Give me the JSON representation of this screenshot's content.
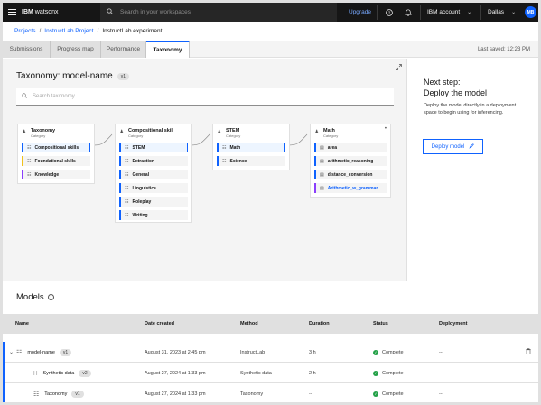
{
  "header": {
    "brand_bold": "IBM",
    "brand_rest": "watsonx",
    "search_placeholder": "Search in your workspaces",
    "upgrade": "Upgrade",
    "account": "IBM account",
    "region": "Dallas",
    "avatar_initials": "MB"
  },
  "breadcrumb": {
    "items": [
      "Projects",
      "InstructLab Project",
      "InstructLab experiment"
    ]
  },
  "tabs": {
    "items": [
      "Submissions",
      "Progress map",
      "Performance",
      "Taxonomy"
    ],
    "active": "Taxonomy",
    "last_saved": "Last saved: 12:23 PM"
  },
  "taxonomy": {
    "title": "Taxonomy: model-name",
    "tag": "v1",
    "search_placeholder": "Search taxonomy",
    "cards": [
      {
        "title": "Taxonomy",
        "subtitle": "Category",
        "nodes": [
          "Compositional skills",
          "Foundational skills",
          "Knowledge"
        ]
      },
      {
        "title": "Compositional skill",
        "subtitle": "Category",
        "nodes": [
          "STEM",
          "Extraction",
          "General",
          "Linguistics",
          "Roleplay",
          "Writing"
        ]
      },
      {
        "title": "STEM",
        "subtitle": "Category",
        "nodes": [
          "Math",
          "Science"
        ]
      },
      {
        "title": "Math",
        "subtitle": "Category",
        "nodes": [
          "area",
          "arithmetic_reasoning",
          "distance_conversion",
          "Arithmetic_w_grammar"
        ]
      }
    ]
  },
  "next_step": {
    "title_line1": "Next step:",
    "title_line2": "Deploy the model",
    "description": "Deploy the model directly in a deployment space to begin using for inferencing.",
    "button": "Deploy model"
  },
  "models": {
    "title": "Models",
    "columns": [
      "Name",
      "Date created",
      "Method",
      "Duration",
      "Status",
      "Deployment"
    ],
    "rows": [
      {
        "name": "model-name",
        "tag": "v1",
        "date": "August 31, 2023 at 2:45 pm",
        "method": "InstructLab",
        "duration": "3 h",
        "status": "Complete",
        "deployment": "--"
      },
      {
        "name": "Synthetic data",
        "tag": "v2",
        "date": "August 27, 2024 at 1:33 pm",
        "method": "Synthetic data",
        "duration": "2 h",
        "status": "Complete",
        "deployment": "--"
      },
      {
        "name": "Taxonomy",
        "tag": "v1",
        "date": "August 27, 2024 at 1:33 pm",
        "method": "Taxonomy",
        "duration": "--",
        "status": "Complete",
        "deployment": "--"
      }
    ]
  }
}
